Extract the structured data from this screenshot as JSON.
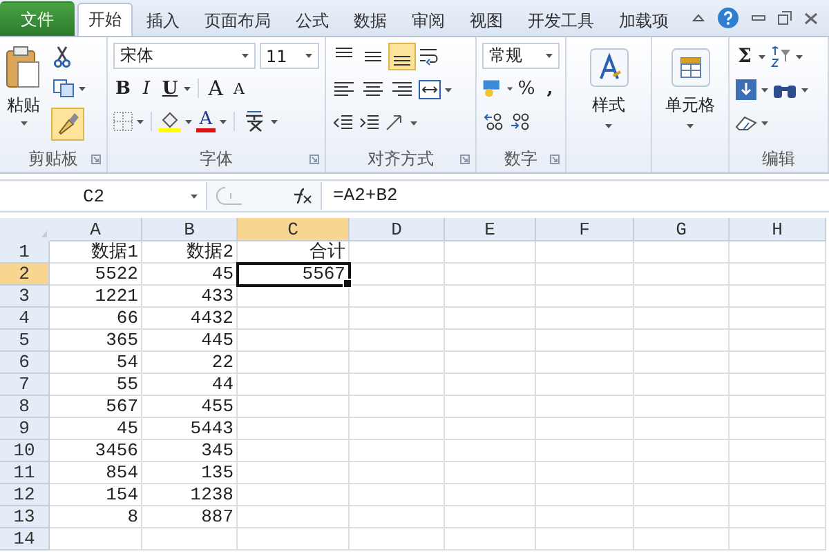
{
  "tabs": [
    {
      "label": "文件",
      "kind": "file",
      "selected": false
    },
    {
      "label": "开始",
      "kind": "tab",
      "selected": true
    },
    {
      "label": "插入",
      "kind": "tab",
      "selected": false
    },
    {
      "label": "页面布局",
      "kind": "tab",
      "selected": false
    },
    {
      "label": "公式",
      "kind": "tab",
      "selected": false
    },
    {
      "label": "数据",
      "kind": "tab",
      "selected": false
    },
    {
      "label": "审阅",
      "kind": "tab",
      "selected": false
    },
    {
      "label": "视图",
      "kind": "tab",
      "selected": false
    },
    {
      "label": "开发工具",
      "kind": "tab",
      "selected": false
    },
    {
      "label": "加载项",
      "kind": "tab",
      "selected": false
    }
  ],
  "ribbon": {
    "clipboard": {
      "label": "剪贴板",
      "paste": "粘贴",
      "format_painter_on": true
    },
    "font": {
      "label": "字体",
      "font_name": "宋体",
      "font_size": "11",
      "bold": "B",
      "italic": "I",
      "underline": "U",
      "grow": "A",
      "shrink": "A",
      "font_color": "A"
    },
    "alignment": {
      "label": "对齐方式",
      "vertical": [
        {
          "selected": false
        },
        {
          "selected": false
        },
        {
          "selected": true
        }
      ]
    },
    "number": {
      "label": "数字",
      "format": "常规",
      "percent": "%",
      "comma": ","
    },
    "styles": {
      "label": "样式"
    },
    "cells": {
      "label": "单元格"
    },
    "editing": {
      "label": "编辑",
      "sum": "Σ"
    }
  },
  "formula_bar": {
    "name_box": "C2",
    "formula": "=A2+B2"
  },
  "sheet": {
    "columns": [
      {
        "label": "A",
        "selected": false
      },
      {
        "label": "B",
        "selected": false
      },
      {
        "label": "C",
        "selected": true
      },
      {
        "label": "D",
        "selected": false
      },
      {
        "label": "E",
        "selected": false
      },
      {
        "label": "F",
        "selected": false
      },
      {
        "label": "G",
        "selected": false
      },
      {
        "label": "H",
        "selected": false
      }
    ],
    "rows": [
      {
        "number": "1",
        "selected": false,
        "cells": [
          "数据1",
          "数据2",
          "合计"
        ]
      },
      {
        "number": "2",
        "selected": true,
        "cells": [
          "5522",
          "45",
          "5567"
        ]
      },
      {
        "number": "3",
        "selected": false,
        "cells": [
          "1221",
          "433",
          ""
        ]
      },
      {
        "number": "4",
        "selected": false,
        "cells": [
          "66",
          "4432",
          ""
        ]
      },
      {
        "number": "5",
        "selected": false,
        "cells": [
          "365",
          "445",
          ""
        ]
      },
      {
        "number": "6",
        "selected": false,
        "cells": [
          "54",
          "22",
          ""
        ]
      },
      {
        "number": "7",
        "selected": false,
        "cells": [
          "55",
          "44",
          ""
        ]
      },
      {
        "number": "8",
        "selected": false,
        "cells": [
          "567",
          "455",
          ""
        ]
      },
      {
        "number": "9",
        "selected": false,
        "cells": [
          "45",
          "5443",
          ""
        ]
      },
      {
        "number": "10",
        "selected": false,
        "cells": [
          "3456",
          "345",
          ""
        ]
      },
      {
        "number": "11",
        "selected": false,
        "cells": [
          "854",
          "135",
          ""
        ]
      },
      {
        "number": "12",
        "selected": false,
        "cells": [
          "154",
          "1238",
          ""
        ]
      },
      {
        "number": "13",
        "selected": false,
        "cells": [
          "8",
          "887",
          ""
        ]
      },
      {
        "number": "14",
        "selected": false,
        "cells": [
          "",
          "",
          ""
        ]
      }
    ]
  }
}
